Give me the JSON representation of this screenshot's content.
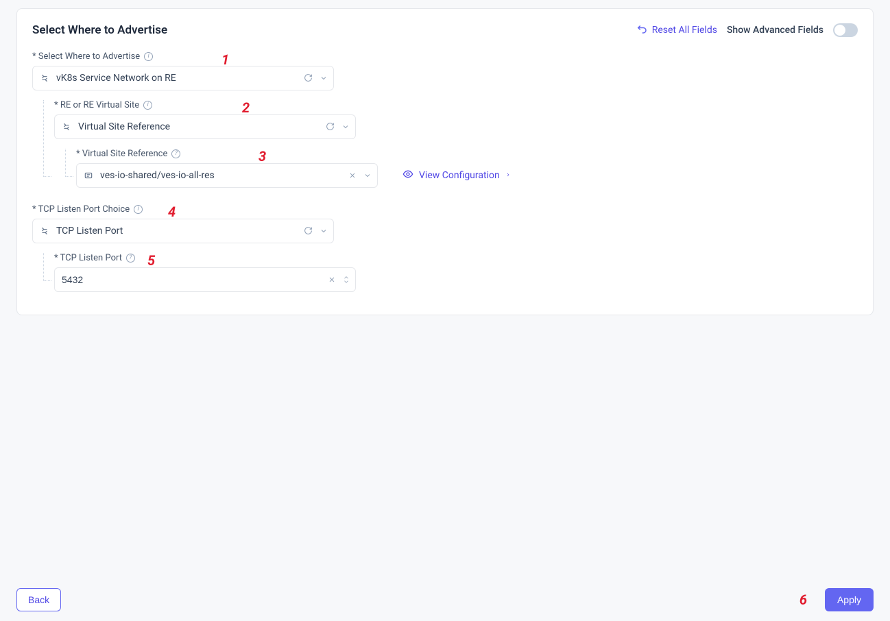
{
  "header": {
    "title": "Select Where to Advertise",
    "reset_label": "Reset All Fields",
    "advanced_label": "Show Advanced Fields"
  },
  "fields": {
    "advertise_where": {
      "label": "* Select Where to Advertise",
      "value": "vK8s Service Network on RE"
    },
    "re_virtual_site": {
      "label": "* RE or RE Virtual Site",
      "value": "Virtual Site Reference"
    },
    "virtual_site_ref": {
      "label": "* Virtual Site Reference",
      "value": "ves-io-shared/ves-io-all-res",
      "view_config_label": "View Configuration"
    },
    "port_choice": {
      "label": "* TCP Listen Port Choice",
      "value": "TCP Listen Port"
    },
    "tcp_port": {
      "label": "* TCP Listen Port",
      "value": "5432"
    }
  },
  "footer": {
    "back_label": "Back",
    "apply_label": "Apply"
  },
  "annotations": {
    "n1": "1",
    "n2": "2",
    "n3": "3",
    "n4": "4",
    "n5": "5",
    "n6": "6"
  }
}
